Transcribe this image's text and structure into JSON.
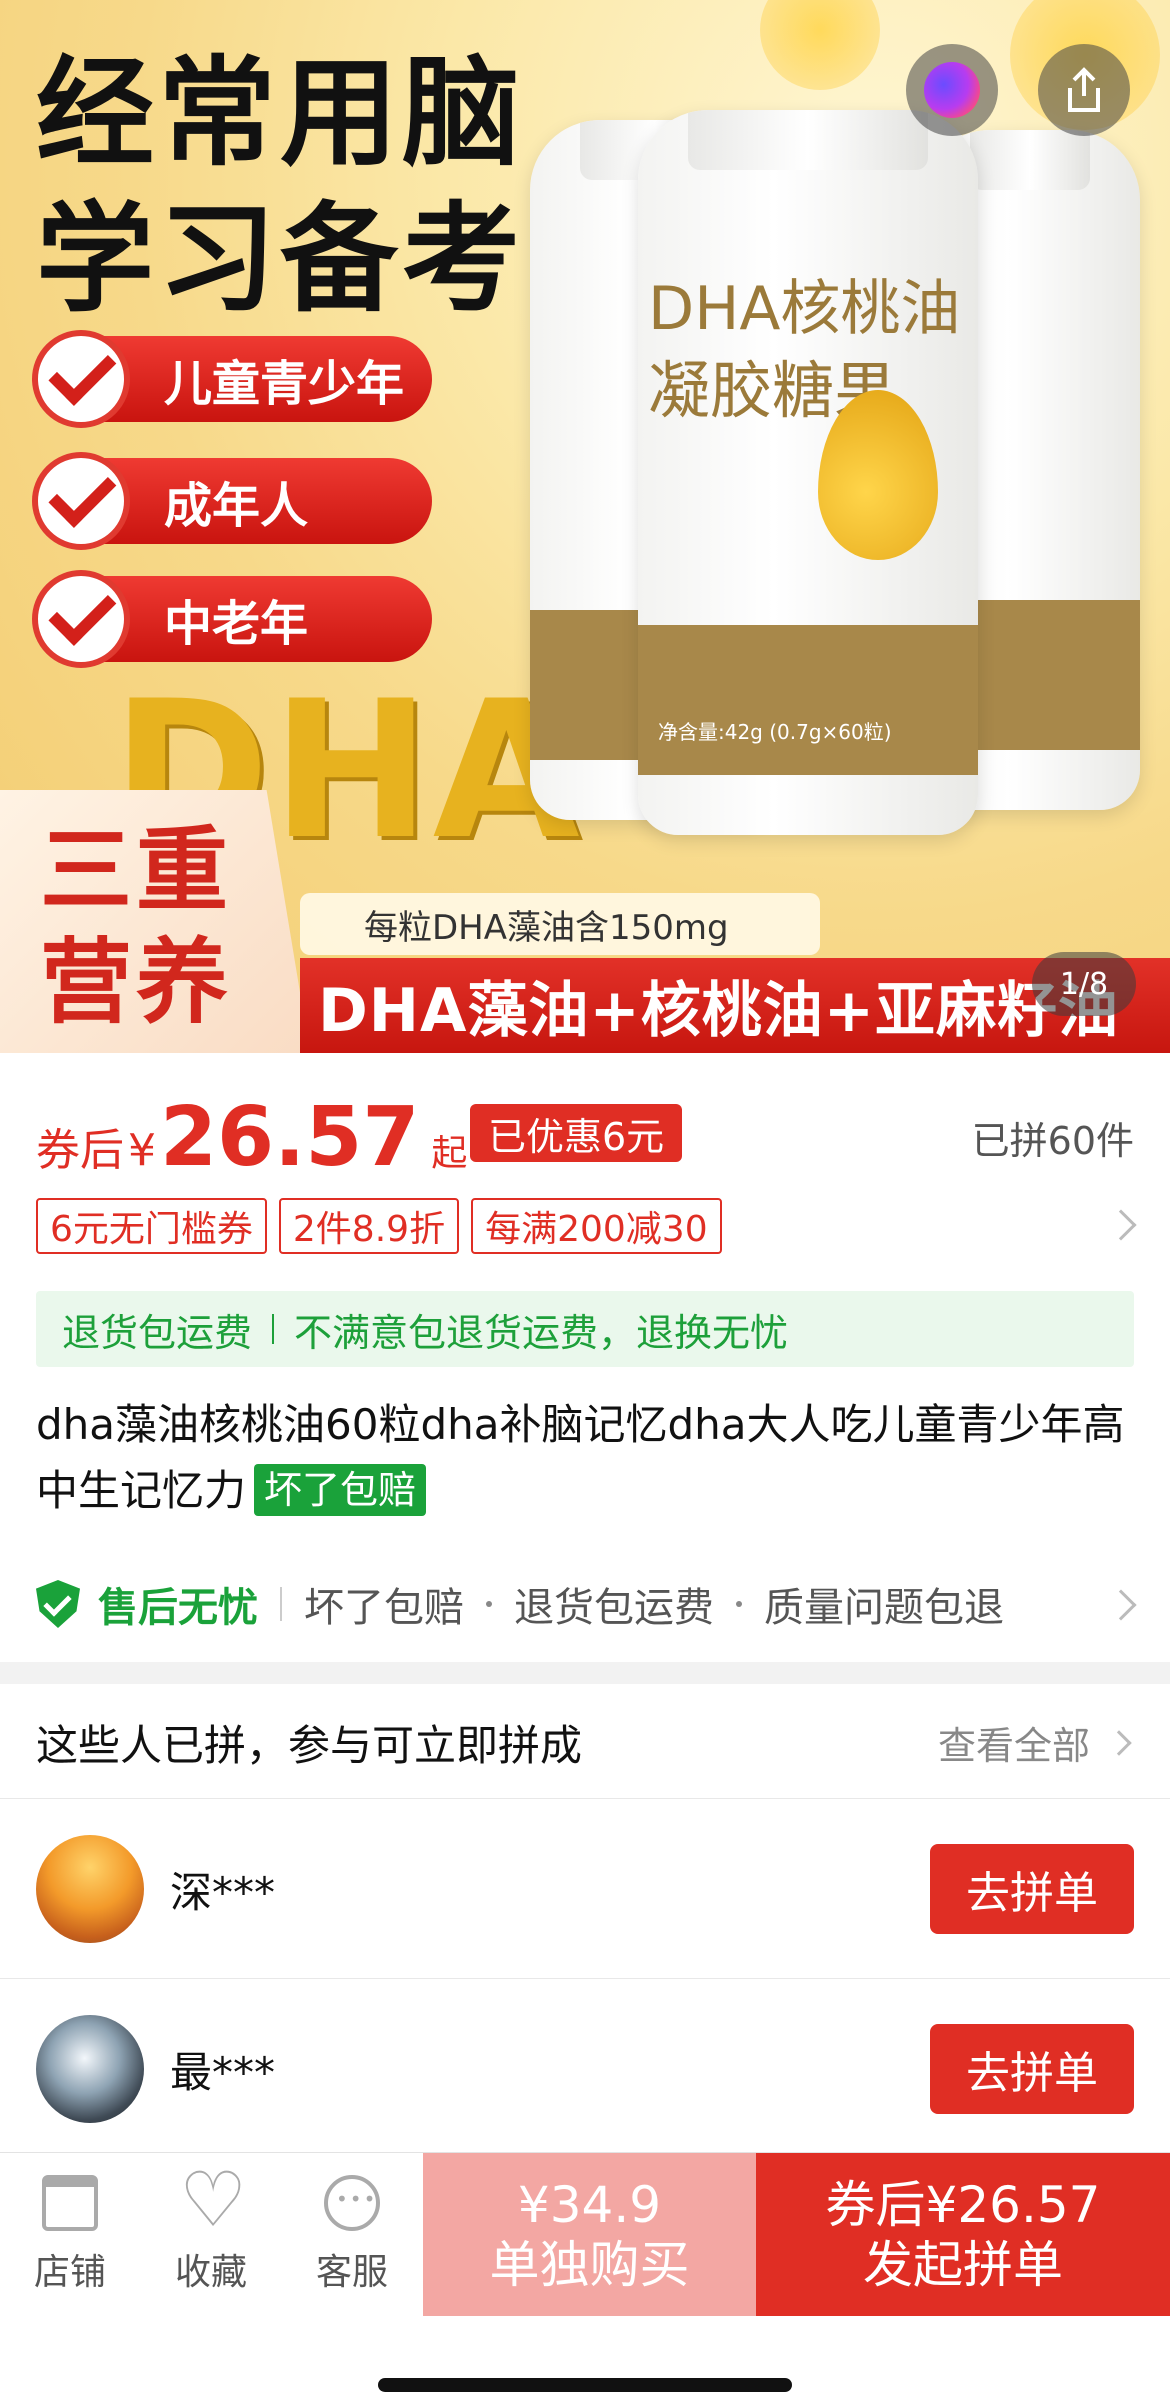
{
  "hero": {
    "headline": [
      "经常用脑",
      "学习备考"
    ],
    "audience_pills": [
      "儿童青少年",
      "成年人",
      "中老年"
    ],
    "big_text": "DHA",
    "bottle_label_line1": "DHA核桃油",
    "bottle_label_line2": "凝胶糖果",
    "net_weight": "净含量:42g (0.7g×60粒)",
    "triple_box": [
      "三重",
      "营养"
    ],
    "per_pill_text": "每粒DHA藻油含150mg",
    "ingredients_bar": "DHA藻油+核桃油+亚麻籽油",
    "pager": "1/8",
    "share_overlay_text": "核桃油"
  },
  "price": {
    "prefix": "券后",
    "currency": "¥",
    "amount": "26.57",
    "suffix": "起",
    "discount_badge": "已优惠6元",
    "sold": "已拼60件"
  },
  "coupons": [
    "6元无门槛券",
    "2件8.9折",
    "每满200减30"
  ],
  "refund": {
    "left": "退货包运费",
    "right": "不满意包退货运费，退换无忧"
  },
  "product": {
    "title": "dha藻油核桃油60粒dha补脑记忆dha大人吃儿童青少年高中生记忆力",
    "tag": "坏了包赔"
  },
  "service": {
    "main": "售后无忧",
    "items": [
      "坏了包赔",
      "退货包运费",
      "质量问题包退"
    ]
  },
  "group": {
    "heading": "这些人已拼，参与可立即拼成",
    "view_all": "查看全部",
    "members": [
      {
        "name": "深***",
        "button": "去拼单"
      },
      {
        "name": "最***",
        "button": "去拼单"
      }
    ]
  },
  "bottom_bar": {
    "store": "店铺",
    "favorite": "收藏",
    "service": "客服",
    "solo_price": "¥34.9",
    "solo_label": "单独购买",
    "group_price": "券后¥26.57",
    "group_label": "发起拼单"
  },
  "colors": {
    "accent_red": "#e02e24",
    "success_green": "#1aa23a",
    "solo_button": "#f3a7a3"
  }
}
